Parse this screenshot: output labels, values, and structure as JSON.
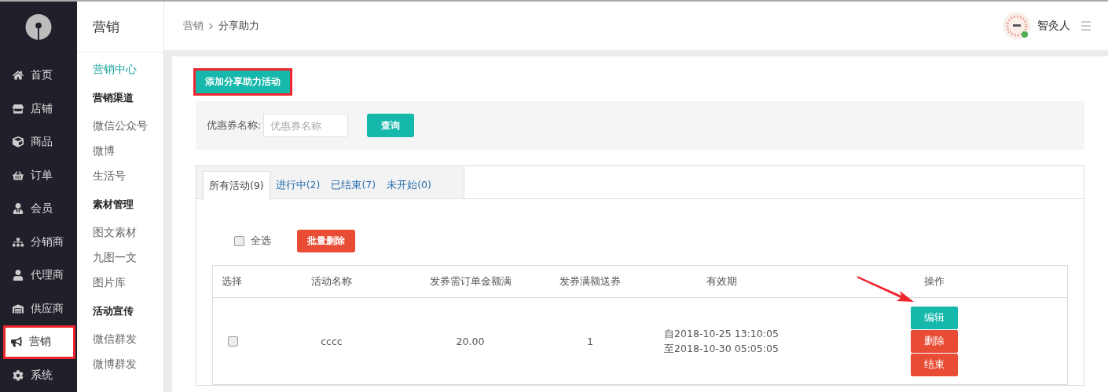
{
  "nav": [
    {
      "label": "首页",
      "selected": false,
      "highlighted": false
    },
    {
      "label": "店铺",
      "selected": false,
      "highlighted": false
    },
    {
      "label": "商品",
      "selected": false,
      "highlighted": false
    },
    {
      "label": "订单",
      "selected": false,
      "highlighted": false
    },
    {
      "label": "会员",
      "selected": false,
      "highlighted": false
    },
    {
      "label": "分销商",
      "selected": false,
      "highlighted": false
    },
    {
      "label": "代理商",
      "selected": false,
      "highlighted": false
    },
    {
      "label": "供应商",
      "selected": false,
      "highlighted": false
    },
    {
      "label": "营销",
      "selected": true,
      "highlighted": true
    },
    {
      "label": "系统",
      "selected": false,
      "highlighted": false
    }
  ],
  "subnav": {
    "title": "营销",
    "items": [
      {
        "kind": "link",
        "label": "营销中心",
        "selected": true
      },
      {
        "kind": "heading",
        "label": "营销渠道"
      },
      {
        "kind": "link",
        "label": "微信公众号",
        "selected": false
      },
      {
        "kind": "link",
        "label": "微博",
        "selected": false
      },
      {
        "kind": "link",
        "label": "生活号",
        "selected": false
      },
      {
        "kind": "heading",
        "label": "素材管理"
      },
      {
        "kind": "link",
        "label": "图文素材",
        "selected": false
      },
      {
        "kind": "link",
        "label": "九图一文",
        "selected": false
      },
      {
        "kind": "link",
        "label": "图片库",
        "selected": false
      },
      {
        "kind": "heading",
        "label": "活动宣传"
      },
      {
        "kind": "link",
        "label": "微信群发",
        "selected": false
      },
      {
        "kind": "link",
        "label": "微博群发",
        "selected": false
      }
    ]
  },
  "breadcrumb": [
    "营销",
    "分享助力"
  ],
  "user": {
    "name": "智灸人"
  },
  "add_button": {
    "label": "添加分享助力活动",
    "highlighted": true
  },
  "filter": {
    "label": "优惠券名称:",
    "placeholder": "优惠券名称",
    "button": "查询"
  },
  "tabs": [
    {
      "label": "所有活动(9)",
      "selected": true
    },
    {
      "label": "进行中(2)",
      "selected": false
    },
    {
      "label": "已结束(7)",
      "selected": false
    },
    {
      "label": "未开始(0)",
      "selected": false
    }
  ],
  "bulk": {
    "select_all": "全选",
    "checked": false,
    "delete_button": "批量删除"
  },
  "table": {
    "columns": [
      "选择",
      "活动名称",
      "发券需订单金额满",
      "发券满额送券",
      "有效期",
      "操作"
    ],
    "rows": [
      {
        "checked": false,
        "name": "cccc",
        "min_amount": "20.00",
        "coupons": "1",
        "validity": [
          "自2018-10-25 13:10:05",
          "至2018-10-30 05:05:05"
        ],
        "actions": [
          {
            "kind": "primary",
            "label": "编辑"
          },
          {
            "kind": "danger",
            "label": "删除"
          },
          {
            "kind": "danger",
            "label": "结束"
          }
        ]
      }
    ]
  }
}
